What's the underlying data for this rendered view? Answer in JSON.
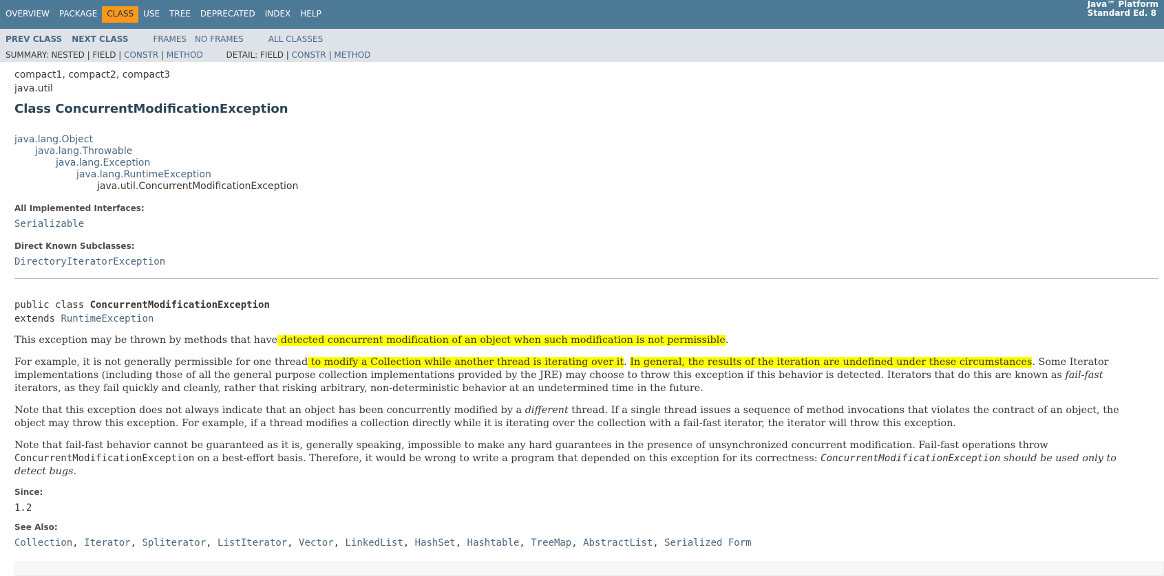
{
  "topnav": {
    "items": [
      "OVERVIEW",
      "PACKAGE",
      "CLASS",
      "USE",
      "TREE",
      "DEPRECATED",
      "INDEX",
      "HELP"
    ],
    "platform_line1": "Java™ Platform",
    "platform_line2": "Standard Ed. 8"
  },
  "subnav": {
    "prev_class": "PREV CLASS",
    "next_class": "NEXT CLASS",
    "frames": "FRAMES",
    "no_frames": "NO FRAMES",
    "all_classes": "ALL CLASSES",
    "summary_prefix": "SUMMARY: NESTED | FIELD | ",
    "summary_constr": "CONSTR",
    "summary_sep": " | ",
    "summary_method": "METHOD",
    "detail_prefix": "DETAIL: FIELD | ",
    "detail_constr": "CONSTR",
    "detail_sep": " | ",
    "detail_method": "METHOD"
  },
  "header": {
    "profiles": "compact1, compact2, compact3",
    "package": "java.util",
    "title": "Class ConcurrentModificationException"
  },
  "inheritance": [
    "java.lang.Object",
    "java.lang.Throwable",
    "java.lang.Exception",
    "java.lang.RuntimeException",
    "java.util.ConcurrentModificationException"
  ],
  "interfaces": {
    "label": "All Implemented Interfaces:",
    "value": "Serializable"
  },
  "subclasses": {
    "label": "Direct Known Subclasses:",
    "value": "DirectoryIteratorException"
  },
  "signature": {
    "prefix": "public class ",
    "name": "ConcurrentModificationException",
    "extends": "extends ",
    "superclass": "RuntimeException"
  },
  "description": {
    "p1_a": "This exception may be thrown by methods that have",
    "p1_hl": " detected concurrent modification of an object when such modification is not permissible",
    "p1_b": ".",
    "p2_a": "For example, it is not generally permissible for one thread",
    "p2_hl1": " to modify a Collection while another thread is iterating over it",
    "p2_b": ". ",
    "p2_hl2": "In general, the results of the iteration are undefined under these circumstances",
    "p2_c": ". Some Iterator implementations (including those of all the general purpose collection implementations provided by the JRE) may choose to throw this exception if this behavior is detected. Iterators that do this are known as ",
    "p2_em": "fail-fast",
    "p2_d": " iterators, as they fail quickly and cleanly, rather that risking arbitrary, non-deterministic behavior at an undetermined time in the future.",
    "p3_a": "Note that this exception does not always indicate that an object has been concurrently modified by a ",
    "p3_em": "different",
    "p3_b": " thread. If a single thread issues a sequence of method invocations that violates the contract of an object, the object may throw this exception. For example, if a thread modifies a collection directly while it is iterating over the collection with a fail-fast iterator, the iterator will throw this exception.",
    "p4_a": "Note that fail-fast behavior cannot be guaranteed as it is, generally speaking, impossible to make any hard guarantees in the presence of unsynchronized concurrent modification. Fail-fast operations throw ",
    "p4_code": "ConcurrentModificationException",
    "p4_b": " on a best-effort basis. Therefore, it would be wrong to write a program that depended on this exception for its correctness: ",
    "p4_em_code": "ConcurrentModificationException",
    "p4_em": " should be used only to detect bugs."
  },
  "since": {
    "label": "Since:",
    "value": "1.2"
  },
  "see_also": {
    "label": "See Also:",
    "links": [
      "Collection",
      "Iterator",
      "Spliterator",
      "ListIterator",
      "Vector",
      "LinkedList",
      "HashSet",
      "Hashtable",
      "TreeMap",
      "AbstractList",
      "Serialized Form"
    ],
    "separator": ", "
  },
  "colors": {
    "nav_bg": "#4d7a97",
    "active_tab": "#f8981d",
    "subnav_bg": "#dee3e9",
    "highlight": "#ffff00",
    "link": "#4a6782"
  }
}
